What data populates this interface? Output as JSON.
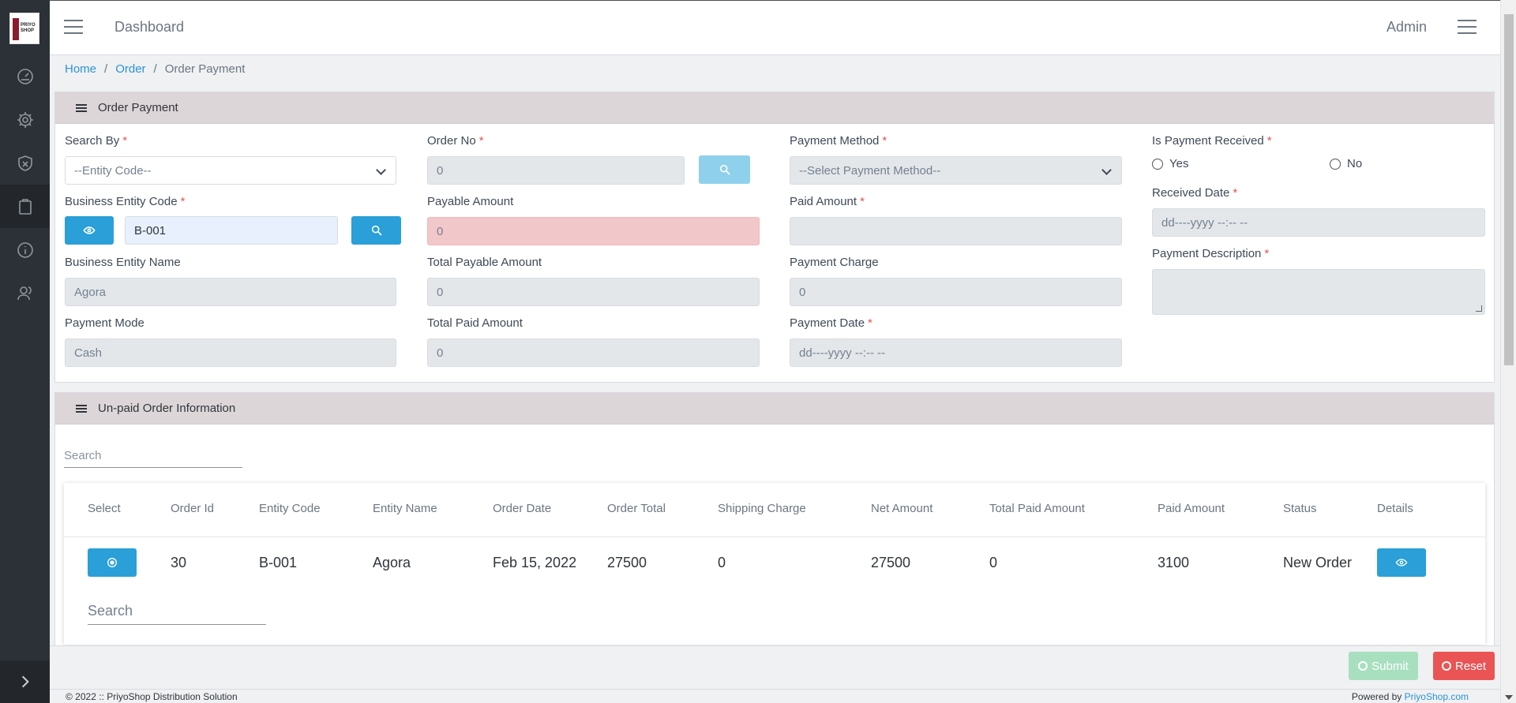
{
  "header": {
    "title": "Dashboard",
    "user": "Admin"
  },
  "logo": {
    "text": "PRIYO SHOP"
  },
  "sidebar": {
    "items": [
      {
        "icon": "speedometer-icon"
      },
      {
        "icon": "gear-icon"
      },
      {
        "icon": "shield-icon"
      },
      {
        "icon": "clipboard-icon",
        "active": true
      },
      {
        "icon": "info-icon"
      },
      {
        "icon": "user-icon"
      }
    ]
  },
  "breadcrumb": {
    "home": "Home",
    "order": "Order",
    "current": "Order Payment"
  },
  "payment_card": {
    "title": "Order Payment",
    "search_by": {
      "label": "Search By",
      "value": "--Entity Code--"
    },
    "order_no": {
      "label": "Order No",
      "value": "0"
    },
    "payment_method": {
      "label": "Payment Method",
      "value": "--Select Payment Method--"
    },
    "is_payment_received": {
      "label": "Is Payment Received",
      "yes": "Yes",
      "no": "No"
    },
    "business_entity_code": {
      "label": "Business Entity Code",
      "value": "B-001"
    },
    "payable_amount": {
      "label": "Payable Amount",
      "value": "0"
    },
    "paid_amount": {
      "label": "Paid Amount",
      "value": ""
    },
    "received_date": {
      "label": "Received Date",
      "placeholder": "dd----yyyy --:-- --"
    },
    "business_entity_name": {
      "label": "Business Entity Name",
      "value": "Agora"
    },
    "total_payable_amount": {
      "label": "Total Payable Amount",
      "value": "0"
    },
    "payment_charge": {
      "label": "Payment Charge",
      "value": "0"
    },
    "payment_description": {
      "label": "Payment Description",
      "value": ""
    },
    "payment_mode": {
      "label": "Payment Mode",
      "value": "Cash"
    },
    "total_paid_amount": {
      "label": "Total Paid Amount",
      "value": "0"
    },
    "payment_date": {
      "label": "Payment Date",
      "placeholder": "dd----yyyy --:-- --"
    }
  },
  "unpaid_card": {
    "title": "Un-paid Order Information",
    "search_placeholder": "Search",
    "columns": [
      "Select",
      "Order Id",
      "Entity Code",
      "Entity Name",
      "Order Date",
      "Order Total",
      "Shipping Charge",
      "Net Amount",
      "Total Paid Amount",
      "Paid Amount",
      "Status",
      "Details"
    ],
    "rows": [
      {
        "order_id": "30",
        "entity_code": "B-001",
        "entity_name": "Agora",
        "order_date": "Feb 15, 2022",
        "order_total": "27500",
        "shipping_charge": "0",
        "net_amount": "27500",
        "total_paid_amount": "0",
        "paid_amount": "3100",
        "status": "New Order"
      }
    ],
    "table_search_placeholder": "Search"
  },
  "actions": {
    "submit": "Submit",
    "reset": "Reset"
  },
  "footer": {
    "copyright": "© 2022 :: PriyoShop Distribution Solution",
    "powered_by": "Powered by",
    "powered_link": "PriyoShop.com"
  },
  "colors": {
    "primary": "#2a9fd8",
    "danger": "#ea5455",
    "success_disabled": "#a8dfbf",
    "card_header": "#ddd6d8",
    "sidebar": "#2c3137"
  }
}
